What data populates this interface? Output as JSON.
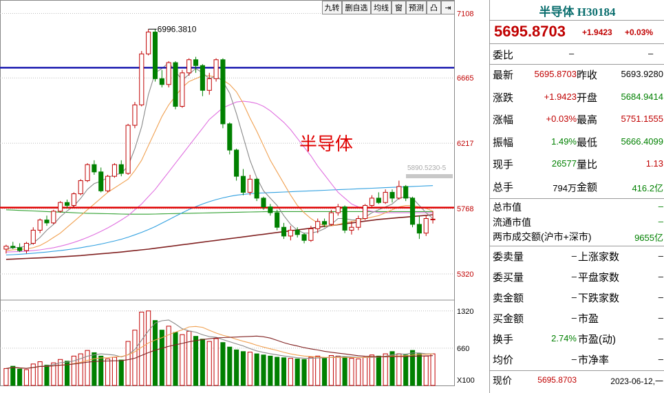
{
  "toolbar": [
    "九转",
    "删自选",
    "均线",
    "窗",
    "预测",
    "凸",
    "⇥"
  ],
  "panel": {
    "title": "半导体 H30184",
    "price": "5695.8703",
    "change": "+1.9423",
    "change_pct": "+0.03%",
    "weibi": {
      "label": "委比",
      "value": "–",
      "value2": "–"
    },
    "quote_rows": [
      {
        "l1": "最新",
        "v1": "5695.8703",
        "c1": "red",
        "l2": "昨收",
        "v2": "5693.9280",
        "c2": "blk"
      },
      {
        "l1": "涨跌",
        "v1": "+1.9423",
        "c1": "red",
        "l2": "开盘",
        "v2": "5684.9414",
        "c2": "grn"
      },
      {
        "l1": "涨幅",
        "v1": "+0.03%",
        "c1": "red",
        "l2": "最高",
        "v2": "5751.1555",
        "c2": "red"
      },
      {
        "l1": "振幅",
        "v1": "1.49%",
        "c1": "grn",
        "l2": "最低",
        "v2": "5666.4099",
        "c2": "grn"
      },
      {
        "l1": "现手",
        "v1": "26577",
        "c1": "grn",
        "l2": "量比",
        "v2": "1.13",
        "c2": "red"
      },
      {
        "l1": "总手",
        "v1": "794万",
        "c1": "blk",
        "l2": "金额",
        "v2": "416.2亿",
        "c2": "grn"
      }
    ],
    "market_rows": [
      {
        "label": "总市值",
        "value": "–"
      },
      {
        "label": "流通市值",
        "value": "–"
      },
      {
        "label": "两市成交额(沪市+深市)",
        "value": "9655亿"
      }
    ],
    "stat_rows": [
      {
        "l1": "委卖量",
        "v1": "–",
        "l2": "上涨家数",
        "v2": "–"
      },
      {
        "l1": "委买量",
        "v1": "–",
        "l2": "平盘家数",
        "v2": "–"
      },
      {
        "l1": "卖金额",
        "v1": "–",
        "l2": "下跌家数",
        "v2": "–"
      },
      {
        "l1": "买金额",
        "v1": "–",
        "l2": "市盈",
        "v2": "–"
      },
      {
        "l1": "换手",
        "v1": "2.74%",
        "l2": "市盈(动)",
        "v2": "–"
      },
      {
        "l1": "均价",
        "v1": "–",
        "l2": "市净率",
        "v2": "–"
      }
    ],
    "footer": {
      "label": "现价",
      "price": "5695.8703",
      "date": "2023-06-12,一"
    }
  },
  "chart_data": {
    "type": "candlestick",
    "annotation_text": "半导体",
    "max_label": "6996.3810",
    "ma_label": "5890.5230-5",
    "y_ticks": [
      7108,
      6665,
      6217,
      5768,
      5320
    ],
    "vol_ticks": [
      "1320",
      "660",
      "X100"
    ],
    "ylim": [
      5145,
      7200
    ],
    "vol_max": 1500,
    "hlines": [
      {
        "value": 6735,
        "color": "#1c1cb0"
      },
      {
        "value": 5775,
        "color": "#e00000"
      }
    ],
    "colors": {
      "up": "#c00000",
      "down": "#008000",
      "ma5": "#888888",
      "ma10": "#f0a050",
      "ma20": "#e070e0",
      "ma30": "#30a0e0",
      "ma60": "#30a030",
      "ma120": "#802020"
    },
    "candles": [
      [
        5490,
        5520,
        5460,
        5510
      ],
      [
        5510,
        5540,
        5490,
        5500
      ],
      [
        5500,
        5530,
        5470,
        5480
      ],
      [
        5480,
        5540,
        5460,
        5530
      ],
      [
        5530,
        5640,
        5520,
        5620
      ],
      [
        5620,
        5700,
        5600,
        5690
      ],
      [
        5690,
        5720,
        5650,
        5670
      ],
      [
        5670,
        5760,
        5660,
        5750
      ],
      [
        5750,
        5820,
        5740,
        5810
      ],
      [
        5810,
        5830,
        5770,
        5790
      ],
      [
        5790,
        5880,
        5780,
        5870
      ],
      [
        5870,
        5970,
        5860,
        5960
      ],
      [
        5960,
        6080,
        5950,
        6070
      ],
      [
        6070,
        6100,
        6000,
        6020
      ],
      [
        6020,
        6050,
        5880,
        5890
      ],
      [
        5890,
        6000,
        5880,
        5990
      ],
      [
        5990,
        6080,
        5980,
        6070
      ],
      [
        6070,
        6100,
        5990,
        6010
      ],
      [
        6010,
        6350,
        6000,
        6340
      ],
      [
        6340,
        6500,
        6320,
        6480
      ],
      [
        6480,
        6850,
        6470,
        6830
      ],
      [
        6830,
        7000,
        6820,
        6980
      ],
      [
        6980,
        7000,
        6640,
        6660
      ],
      [
        6660,
        6720,
        6600,
        6620
      ],
      [
        6620,
        6780,
        6600,
        6770
      ],
      [
        6770,
        6780,
        6450,
        6470
      ],
      [
        6470,
        6720,
        6460,
        6700
      ],
      [
        6700,
        6800,
        6680,
        6790
      ],
      [
        6790,
        6810,
        6700,
        6750
      ],
      [
        6750,
        6760,
        6540,
        6580
      ],
      [
        6580,
        6700,
        6550,
        6660
      ],
      [
        6660,
        6800,
        6640,
        6790
      ],
      [
        6790,
        6800,
        6320,
        6350
      ],
      [
        6350,
        6360,
        6140,
        6170
      ],
      [
        6170,
        6180,
        5960,
        5990
      ],
      [
        5990,
        6040,
        5860,
        5880
      ],
      [
        5880,
        6000,
        5860,
        5970
      ],
      [
        5970,
        5980,
        5820,
        5840
      ],
      [
        5840,
        5850,
        5760,
        5780
      ],
      [
        5780,
        5800,
        5720,
        5740
      ],
      [
        5740,
        5760,
        5620,
        5640
      ],
      [
        5640,
        5670,
        5560,
        5580
      ],
      [
        5580,
        5650,
        5550,
        5620
      ],
      [
        5620,
        5640,
        5570,
        5590
      ],
      [
        5590,
        5600,
        5530,
        5550
      ],
      [
        5550,
        5650,
        5540,
        5630
      ],
      [
        5630,
        5700,
        5600,
        5680
      ],
      [
        5680,
        5700,
        5640,
        5660
      ],
      [
        5660,
        5760,
        5650,
        5740
      ],
      [
        5740,
        5800,
        5720,
        5780
      ],
      [
        5780,
        5790,
        5600,
        5620
      ],
      [
        5620,
        5680,
        5590,
        5640
      ],
      [
        5640,
        5720,
        5620,
        5700
      ],
      [
        5700,
        5800,
        5690,
        5790
      ],
      [
        5790,
        5860,
        5780,
        5840
      ],
      [
        5840,
        5880,
        5800,
        5810
      ],
      [
        5810,
        5900,
        5800,
        5880
      ],
      [
        5880,
        5900,
        5810,
        5840
      ],
      [
        5840,
        5960,
        5830,
        5920
      ],
      [
        5920,
        5930,
        5820,
        5840
      ],
      [
        5840,
        5850,
        5640,
        5660
      ],
      [
        5660,
        5720,
        5560,
        5600
      ],
      [
        5600,
        5720,
        5580,
        5700
      ],
      [
        5695,
        5751,
        5666,
        5696
      ]
    ],
    "volumes": [
      300,
      340,
      290,
      280,
      380,
      420,
      360,
      400,
      460,
      430,
      520,
      560,
      620,
      580,
      520,
      470,
      500,
      450,
      780,
      980,
      1300,
      1320,
      1150,
      980,
      1050,
      940,
      900,
      960,
      870,
      820,
      780,
      830,
      760,
      680,
      630,
      600,
      590,
      560,
      540,
      520,
      500,
      490,
      480,
      470,
      460,
      500,
      520,
      490,
      530,
      520,
      500,
      480,
      470,
      500,
      540,
      520,
      560,
      600,
      560,
      540,
      620,
      560,
      520,
      560
    ],
    "ma_series": {
      "ma5": [
        5495,
        5500,
        5502,
        5510,
        5532,
        5570,
        5620,
        5660,
        5712,
        5752,
        5786,
        5838,
        5900,
        5940,
        5956,
        5980,
        6000,
        6010,
        6060,
        6180,
        6330,
        6550,
        6700,
        6730,
        6770,
        6710,
        6650,
        6690,
        6730,
        6700,
        6660,
        6680,
        6640,
        6560,
        6420,
        6260,
        6100,
        5980,
        5890,
        5840,
        5790,
        5720,
        5660,
        5620,
        5600,
        5600,
        5610,
        5630,
        5660,
        5700,
        5700,
        5690,
        5690,
        5710,
        5740,
        5760,
        5780,
        5800,
        5840,
        5850,
        5840,
        5790,
        5740,
        5700
      ],
      "ma10": [
        5480,
        5485,
        5488,
        5492,
        5500,
        5515,
        5540,
        5570,
        5600,
        5640,
        5680,
        5720,
        5760,
        5800,
        5840,
        5880,
        5910,
        5940,
        5970,
        6030,
        6100,
        6200,
        6300,
        6400,
        6480,
        6540,
        6600,
        6640,
        6660,
        6680,
        6680,
        6670,
        6650,
        6620,
        6570,
        6490,
        6390,
        6300,
        6200,
        6100,
        6020,
        5940,
        5860,
        5790,
        5740,
        5700,
        5670,
        5650,
        5650,
        5660,
        5670,
        5680,
        5690,
        5700,
        5710,
        5720,
        5740,
        5760,
        5780,
        5790,
        5790,
        5780,
        5770,
        5750
      ],
      "ma20": [
        5470,
        5472,
        5474,
        5476,
        5480,
        5485,
        5492,
        5500,
        5510,
        5522,
        5536,
        5552,
        5570,
        5590,
        5612,
        5636,
        5662,
        5690,
        5720,
        5760,
        5800,
        5850,
        5900,
        5960,
        6020,
        6080,
        6140,
        6200,
        6260,
        6320,
        6380,
        6420,
        6460,
        6480,
        6500,
        6505,
        6500,
        6490,
        6470,
        6440,
        6400,
        6360,
        6310,
        6250,
        6190,
        6130,
        6060,
        6000,
        5940,
        5880,
        5840,
        5800,
        5780,
        5760,
        5750,
        5740,
        5740,
        5740,
        5740,
        5740,
        5740,
        5740,
        5740,
        5740
      ],
      "ma30": [
        5450,
        5452,
        5455,
        5458,
        5462,
        5466,
        5470,
        5475,
        5480,
        5486,
        5492,
        5500,
        5508,
        5516,
        5525,
        5535,
        5546,
        5558,
        5572,
        5588,
        5605,
        5624,
        5645,
        5668,
        5692,
        5716,
        5740,
        5762,
        5782,
        5800,
        5816,
        5830,
        5842,
        5852,
        5860,
        5866,
        5870,
        5874,
        5876,
        5878,
        5880,
        5882,
        5884,
        5886,
        5888,
        5890,
        5892,
        5894,
        5896,
        5898,
        5900,
        5902,
        5904,
        5906,
        5908,
        5910,
        5912,
        5914,
        5916,
        5918,
        5920,
        5922,
        5924,
        5926
      ],
      "ma60": [
        5760,
        5758,
        5756,
        5754,
        5752,
        5750,
        5748,
        5746,
        5744,
        5742,
        5740,
        5738,
        5736,
        5735,
        5734,
        5733,
        5732,
        5731,
        5730,
        5730,
        5730,
        5730,
        5731,
        5732,
        5733,
        5734,
        5735,
        5736,
        5737,
        5738,
        5739,
        5740,
        5741,
        5742,
        5743,
        5744,
        5745,
        5746,
        5747,
        5748,
        5748,
        5748,
        5748,
        5748,
        5748,
        5748,
        5748,
        5748,
        5748,
        5748,
        5748,
        5748,
        5748,
        5748,
        5748,
        5748,
        5748,
        5748,
        5748,
        5748,
        5748,
        5748,
        5748,
        5748
      ],
      "ma120": [
        5420,
        5422,
        5424,
        5426,
        5428,
        5430,
        5432,
        5434,
        5437,
        5440,
        5443,
        5446,
        5450,
        5454,
        5458,
        5462,
        5466,
        5470,
        5475,
        5480,
        5485,
        5490,
        5496,
        5502,
        5508,
        5514,
        5520,
        5526,
        5532,
        5538,
        5544,
        5550,
        5556,
        5562,
        5568,
        5574,
        5580,
        5586,
        5592,
        5598,
        5604,
        5610,
        5616,
        5622,
        5628,
        5634,
        5640,
        5646,
        5652,
        5658,
        5664,
        5670,
        5676,
        5682,
        5688,
        5694,
        5698,
        5702,
        5706,
        5710,
        5714,
        5718,
        5722,
        5726
      ]
    }
  }
}
